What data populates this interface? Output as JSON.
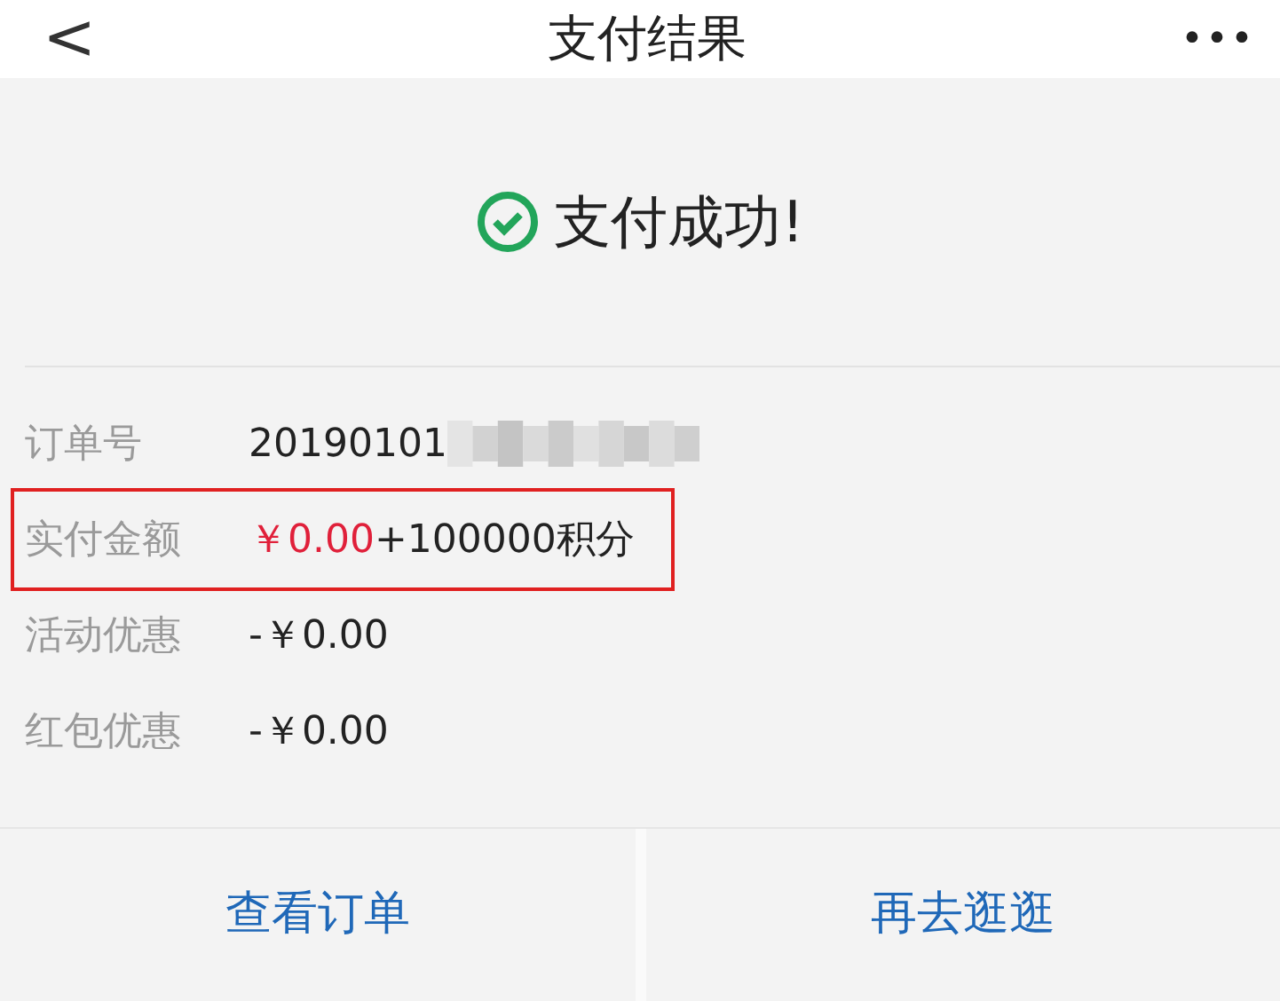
{
  "header": {
    "back": "<",
    "title": "支付结果",
    "more": "•••"
  },
  "status": {
    "text": "支付成功!",
    "success": true
  },
  "details": [
    {
      "label": "订单号",
      "kind": "masked",
      "parts": [
        {
          "text": "20190101",
          "kind": "plain"
        }
      ],
      "highlighted": false
    },
    {
      "label": "实付金额",
      "kind": "amount",
      "parts": [
        {
          "text": "￥0.00",
          "kind": "price"
        },
        {
          "text": "+100000积分",
          "kind": "plain"
        }
      ],
      "highlighted": true
    },
    {
      "label": "活动优惠",
      "kind": "amount",
      "parts": [
        {
          "text": "-￥0.00",
          "kind": "plain"
        }
      ],
      "highlighted": false
    },
    {
      "label": "红包优惠",
      "kind": "amount",
      "parts": [
        {
          "text": "-￥0.00",
          "kind": "plain"
        }
      ],
      "highlighted": false
    }
  ],
  "buttons": [
    "查看订单",
    "再去逛逛"
  ]
}
